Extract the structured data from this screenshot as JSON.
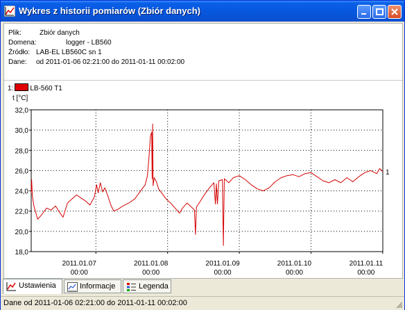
{
  "window": {
    "title": "Wykres z historii pomiarów (Zbiór danych)"
  },
  "info": {
    "file_label": "Plik:",
    "file_value": "Zbiór danych",
    "domain_label": "Domena:",
    "domain_value": "logger - LB560",
    "source_label": "Źródło:",
    "source_value": "LAB-EL LB560C sn 1",
    "data_label": "Dane:",
    "data_value": "od 2011-01-06 02:21:00 do 2011-01-11 00:02:00"
  },
  "legend": {
    "index": "1:",
    "series_name": "LB-560 T1"
  },
  "chart_data": {
    "type": "line",
    "ylabel": "t [°C]",
    "ylim": [
      18,
      32
    ],
    "yticks": [
      "32,0",
      "30,0",
      "28,0",
      "26,0",
      "24,0",
      "22,0",
      "20,0",
      "18,0"
    ],
    "xlim": [
      "2011-01-06 02:21",
      "2011-01-11 00:02"
    ],
    "xticks": [
      {
        "date": "2011.01.07",
        "time": "00:00"
      },
      {
        "date": "2011.01.08",
        "time": "00:00"
      },
      {
        "date": "2011.01.09",
        "time": "00:00"
      },
      {
        "date": "2011.01.10",
        "time": "00:00"
      },
      {
        "date": "2011.01.11",
        "time": "00:00"
      }
    ],
    "grid": true,
    "end_label": "1",
    "series": [
      {
        "name": "LB-560 T1",
        "color": "#d40000",
        "points": [
          [
            "2011-01-06 02:21",
            23.8
          ],
          [
            "2011-01-06 02:30",
            25.1
          ],
          [
            "2011-01-06 02:45",
            23.5
          ],
          [
            "2011-01-06 03:15",
            22.5
          ],
          [
            "2011-01-06 04:30",
            21.2
          ],
          [
            "2011-01-06 05:45",
            21.6
          ],
          [
            "2011-01-06 07:30",
            22.3
          ],
          [
            "2011-01-06 09:00",
            22.1
          ],
          [
            "2011-01-06 10:30",
            22.5
          ],
          [
            "2011-01-06 12:00",
            21.8
          ],
          [
            "2011-01-06 13:00",
            21.4
          ],
          [
            "2011-01-06 14:30",
            22.8
          ],
          [
            "2011-01-06 16:00",
            23.2
          ],
          [
            "2011-01-06 17:30",
            23.6
          ],
          [
            "2011-01-06 19:00",
            23.3
          ],
          [
            "2011-01-06 20:30",
            23.0
          ],
          [
            "2011-01-06 22:00",
            22.6
          ],
          [
            "2011-01-06 23:30",
            23.4
          ],
          [
            "2011-01-07 00:15",
            24.6
          ],
          [
            "2011-01-07 00:45",
            23.8
          ],
          [
            "2011-01-07 01:30",
            24.8
          ],
          [
            "2011-01-07 02:15",
            23.9
          ],
          [
            "2011-01-07 03:00",
            24.3
          ],
          [
            "2011-01-07 04:00",
            23.5
          ],
          [
            "2011-01-07 05:00",
            22.6
          ],
          [
            "2011-01-07 06:00",
            22.0
          ],
          [
            "2011-01-07 07:30",
            22.2
          ],
          [
            "2011-01-07 09:00",
            22.5
          ],
          [
            "2011-01-07 11:00",
            22.8
          ],
          [
            "2011-01-07 13:00",
            23.2
          ],
          [
            "2011-01-07 15:00",
            24.0
          ],
          [
            "2011-01-07 16:30",
            24.6
          ],
          [
            "2011-01-07 17:15",
            25.5
          ],
          [
            "2011-01-07 17:45",
            27.2
          ],
          [
            "2011-01-07 18:15",
            29.4
          ],
          [
            "2011-01-07 18:40",
            29.8
          ],
          [
            "2011-01-07 18:50",
            25.2
          ],
          [
            "2011-01-07 19:00",
            30.6
          ],
          [
            "2011-01-07 19:10",
            24.5
          ],
          [
            "2011-01-07 19:30",
            25.3
          ],
          [
            "2011-01-07 20:15",
            24.9
          ],
          [
            "2011-01-07 21:00",
            24.2
          ],
          [
            "2011-01-07 22:30",
            23.6
          ],
          [
            "2011-01-07 23:30",
            23.2
          ],
          [
            "2011-01-08 01:00",
            22.8
          ],
          [
            "2011-01-08 02:30",
            22.3
          ],
          [
            "2011-01-08 04:00",
            21.8
          ],
          [
            "2011-01-08 05:00",
            22.3
          ],
          [
            "2011-01-08 06:30",
            22.8
          ],
          [
            "2011-01-08 08:00",
            22.4
          ],
          [
            "2011-01-08 09:00",
            22.1
          ],
          [
            "2011-01-08 09:20",
            19.7
          ],
          [
            "2011-01-08 09:40",
            22.4
          ],
          [
            "2011-01-08 11:00",
            23.0
          ],
          [
            "2011-01-08 12:30",
            23.7
          ],
          [
            "2011-01-08 14:00",
            24.3
          ],
          [
            "2011-01-08 15:30",
            24.8
          ],
          [
            "2011-01-08 16:00",
            22.7
          ],
          [
            "2011-01-08 16:20",
            24.7
          ],
          [
            "2011-01-08 16:40",
            22.7
          ],
          [
            "2011-01-08 17:10",
            25.0
          ],
          [
            "2011-01-08 18:20",
            25.1
          ],
          [
            "2011-01-08 18:40",
            18.6
          ],
          [
            "2011-01-08 19:00",
            25.2
          ],
          [
            "2011-01-08 20:30",
            24.8
          ],
          [
            "2011-01-08 22:00",
            25.3
          ],
          [
            "2011-01-09 00:00",
            25.5
          ],
          [
            "2011-01-09 02:00",
            25.1
          ],
          [
            "2011-01-09 04:00",
            24.6
          ],
          [
            "2011-01-09 06:00",
            24.2
          ],
          [
            "2011-01-09 08:00",
            24.0
          ],
          [
            "2011-01-09 10:00",
            24.3
          ],
          [
            "2011-01-09 12:00",
            24.9
          ],
          [
            "2011-01-09 14:00",
            25.3
          ],
          [
            "2011-01-09 16:00",
            25.5
          ],
          [
            "2011-01-09 18:00",
            25.6
          ],
          [
            "2011-01-09 20:00",
            25.4
          ],
          [
            "2011-01-09 22:00",
            25.7
          ],
          [
            "2011-01-10 00:00",
            25.8
          ],
          [
            "2011-01-10 02:00",
            25.4
          ],
          [
            "2011-01-10 04:00",
            25.0
          ],
          [
            "2011-01-10 06:00",
            24.8
          ],
          [
            "2011-01-10 08:00",
            25.1
          ],
          [
            "2011-01-10 10:00",
            24.8
          ],
          [
            "2011-01-10 12:00",
            25.3
          ],
          [
            "2011-01-10 14:00",
            24.9
          ],
          [
            "2011-01-10 16:00",
            25.4
          ],
          [
            "2011-01-10 18:00",
            25.8
          ],
          [
            "2011-01-10 20:00",
            26.0
          ],
          [
            "2011-01-10 22:00",
            25.7
          ],
          [
            "2011-01-10 23:00",
            26.2
          ],
          [
            "2011-01-11 00:02",
            25.9
          ]
        ]
      }
    ]
  },
  "tabs": [
    {
      "label": "Ustawienia",
      "icon": "chart-icon",
      "active": true
    },
    {
      "label": "Informacje",
      "icon": "info-chart-icon",
      "active": false
    },
    {
      "label": "Legenda",
      "icon": "legend-icon",
      "active": false
    }
  ],
  "status": {
    "text": "Dane od 2011-01-06 02:21:00 do 2011-01-11 00:02:00"
  },
  "colors": {
    "titlebar": "#0756dc",
    "series": "#d40000",
    "grid": "#000000"
  }
}
